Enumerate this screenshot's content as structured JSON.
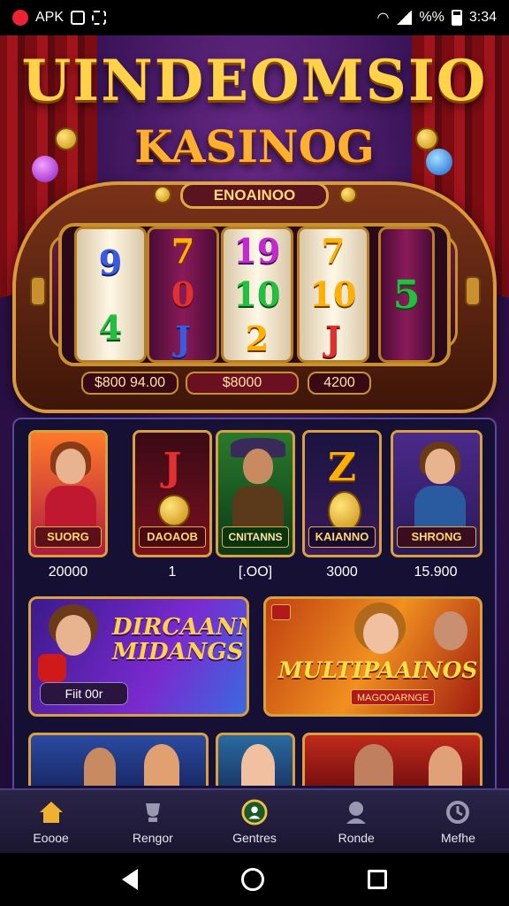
{
  "status_bar": {
    "left_label": "APK",
    "battery_percent": "%%",
    "time": "3:34"
  },
  "header": {
    "title_line1": "UINDEOMSIO",
    "title_line2": "KASINOG"
  },
  "slot_machine": {
    "plaque": "ENOAINOO",
    "reels": [
      [
        "9",
        "4"
      ],
      [
        "7",
        "0",
        "J"
      ],
      [
        "19",
        "10",
        "2"
      ],
      [
        "7",
        "10",
        "J"
      ],
      [
        "5"
      ]
    ],
    "meters": [
      "$800 94.00",
      "$8000",
      "4200"
    ]
  },
  "game_tiles": [
    {
      "label": "SUORG",
      "value": "20000"
    },
    {
      "label": "DAOAOB",
      "symbol": "J",
      "value": "1"
    },
    {
      "label": "CNITANNS",
      "value": "[.OO]"
    },
    {
      "label": "KAIANNO",
      "symbol": "Z",
      "value": "3000"
    },
    {
      "label": "SHRONG",
      "value": "15.900"
    }
  ],
  "banners": [
    {
      "title": "DIRCAANN MIDANGS",
      "pill": "Fiit 00r"
    },
    {
      "title": "MULTIPAAINOS",
      "badge": "MAGOOARNGE"
    }
  ],
  "bottom_nav": [
    {
      "label": "Eoooe",
      "icon": "home-icon"
    },
    {
      "label": "Rengor",
      "icon": "trophy-icon"
    },
    {
      "label": "Gentres",
      "icon": "games-icon"
    },
    {
      "label": "Ronde",
      "icon": "profile-icon"
    },
    {
      "label": "Mefhe",
      "icon": "refresh-icon"
    }
  ],
  "colors": {
    "gold": "#ffd24a",
    "accent_orange": "#ffb02e",
    "panel": "#141032",
    "nav_bg": "#1a1630"
  }
}
